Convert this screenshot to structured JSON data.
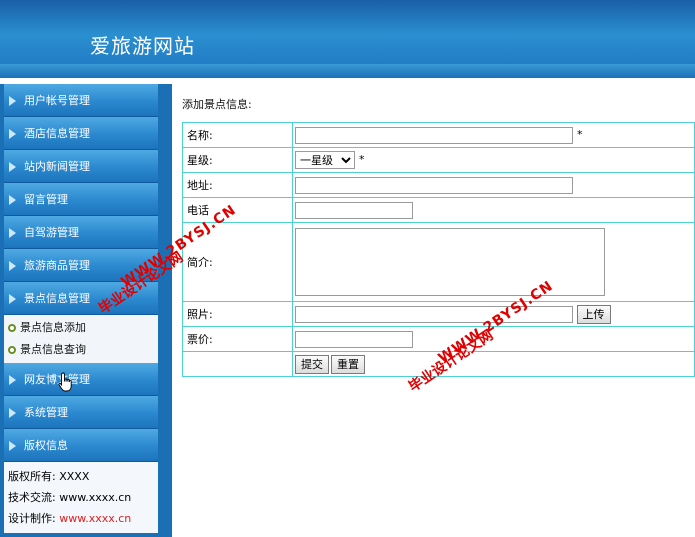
{
  "header": {
    "title": "爱旅游网站"
  },
  "sidebar": {
    "items": [
      {
        "label": "用户帐号管理"
      },
      {
        "label": "酒店信息管理"
      },
      {
        "label": "站内新闻管理"
      },
      {
        "label": "留言管理"
      },
      {
        "label": "自驾游管理"
      },
      {
        "label": "旅游商品管理"
      },
      {
        "label": "景点信息管理"
      }
    ],
    "submenu": [
      {
        "label": "景点信息添加"
      },
      {
        "label": "景点信息查询"
      }
    ],
    "items_after": [
      {
        "label": "网友博文管理"
      },
      {
        "label": "系统管理"
      },
      {
        "label": "版权信息"
      }
    ],
    "info": {
      "copyright_label": "版权所有:",
      "copyright_value": "XXXX",
      "tech_label": "技术交流:",
      "tech_value": "www.xxxx.cn",
      "design_label": "设计制作:",
      "design_value": "www.xxxx.cn"
    }
  },
  "form": {
    "title": "添加景点信息:",
    "name_label": "名称:",
    "star": "*",
    "level_label": "星级:",
    "level_selected": "一星级",
    "address_label": "地址:",
    "phone_label": "电话",
    "intro_label": "简介:",
    "photo_label": "照片:",
    "upload_label": "上传",
    "price_label": "票价:",
    "submit_label": "提交",
    "reset_label": "重置"
  },
  "watermark": {
    "site": "WWW.2BYSJ.CN",
    "name": "毕业设计论文网"
  }
}
